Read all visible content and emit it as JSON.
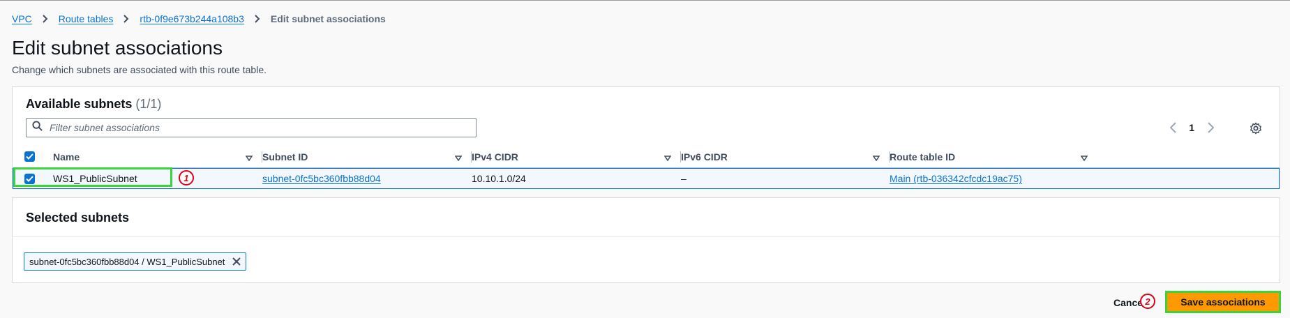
{
  "breadcrumb": {
    "items": [
      "VPC",
      "Route tables",
      "rtb-0f9e673b244a108b3"
    ],
    "current": "Edit subnet associations"
  },
  "page": {
    "title": "Edit subnet associations",
    "description": "Change which subnets are associated with this route table."
  },
  "available": {
    "heading": "Available subnets",
    "count": "(1/1)",
    "filter_placeholder": "Filter subnet associations",
    "page_number": "1",
    "columns": [
      "Name",
      "Subnet ID",
      "IPv4 CIDR",
      "IPv6 CIDR",
      "Route table ID"
    ],
    "rows": [
      {
        "selected": true,
        "name": "WS1_PublicSubnet",
        "subnet_id": "subnet-0fc5bc360fbb88d04",
        "ipv4": "10.10.1.0/24",
        "ipv6": "–",
        "route_table": "Main (rtb-036342cfcdc19ac75)"
      }
    ]
  },
  "selected": {
    "heading": "Selected subnets",
    "token": "subnet-0fc5bc360fbb88d04 / WS1_PublicSubnet"
  },
  "footer": {
    "cancel": "Cancel",
    "save": "Save associations"
  },
  "annotations": [
    "1",
    "2"
  ],
  "colors": {
    "accent": "#0972d3",
    "primary_button": "#ff9900",
    "highlight": "#3bd43b",
    "marker": "#e1001a"
  }
}
